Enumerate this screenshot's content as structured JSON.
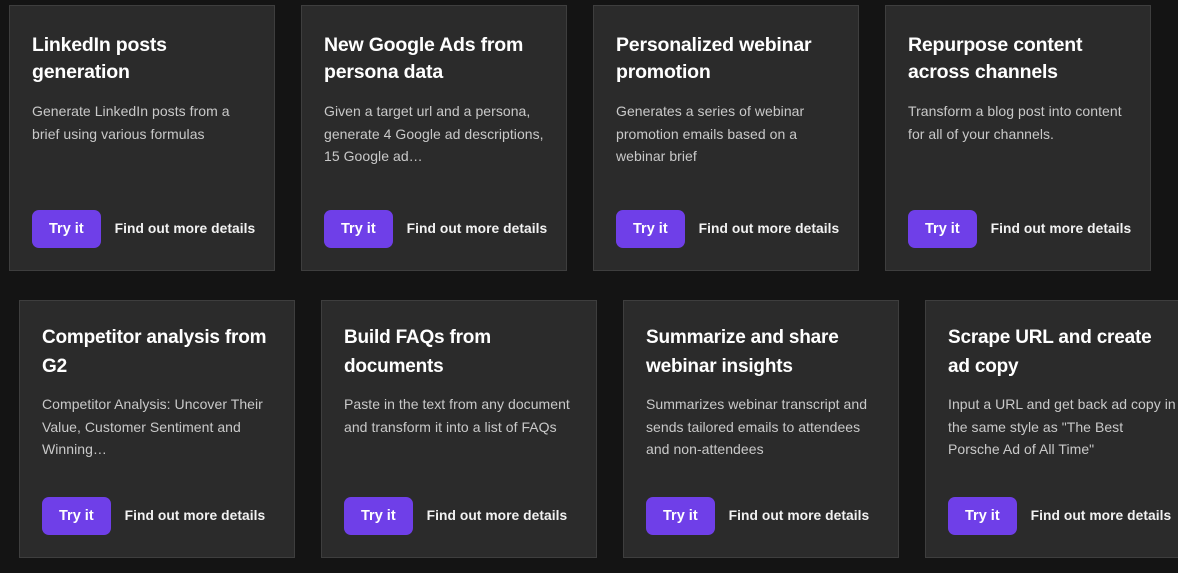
{
  "theme": {
    "page_background": "#141414",
    "card_background": "#2b2b2b",
    "card_border": "#3e3e3e",
    "accent": "#6f3fe8",
    "title_color": "#ffffff",
    "description_color": "#c9c9c9"
  },
  "labels": {
    "try_it": "Try it",
    "find_out_more": "Find out more details"
  },
  "rows": [
    {
      "cards": [
        {
          "title": "LinkedIn posts generation",
          "description": "Generate LinkedIn posts from a brief using various formulas",
          "try_label": "Try it",
          "details_label": "Find out more details"
        },
        {
          "title": "New Google Ads from persona data",
          "description": "Given a target url and a persona, generate 4 Google ad descriptions, 15 Google ad…",
          "try_label": "Try it",
          "details_label": "Find out more details"
        },
        {
          "title": "Personalized webinar promotion",
          "description": "Generates a series of webinar promotion emails based on a webinar brief",
          "try_label": "Try it",
          "details_label": "Find out more details"
        },
        {
          "title": "Repurpose content across channels",
          "description": "Transform a blog post into content for all of your channels.",
          "try_label": "Try it",
          "details_label": "Find out more details"
        }
      ]
    },
    {
      "cards": [
        {
          "title": "Competitor analysis from G2",
          "description": "Competitor Analysis: Uncover Their Value, Customer Sentiment and Winning…",
          "try_label": "Try it",
          "details_label": "Find out more details"
        },
        {
          "title": "Build FAQs from documents",
          "description": "Paste in the text from any document and transform it into a list of FAQs",
          "try_label": "Try it",
          "details_label": "Find out more details"
        },
        {
          "title": "Summarize and share webinar insights",
          "description": "Summarizes webinar transcript and sends tailored emails to attendees and non-attendees",
          "try_label": "Try it",
          "details_label": "Find out more details"
        },
        {
          "title": "Scrape URL and create ad copy",
          "description": "Input a URL and get back ad copy in the same style as \"The Best Porsche Ad of All Time\"",
          "try_label": "Try it",
          "details_label": "Find out more details"
        }
      ]
    }
  ]
}
